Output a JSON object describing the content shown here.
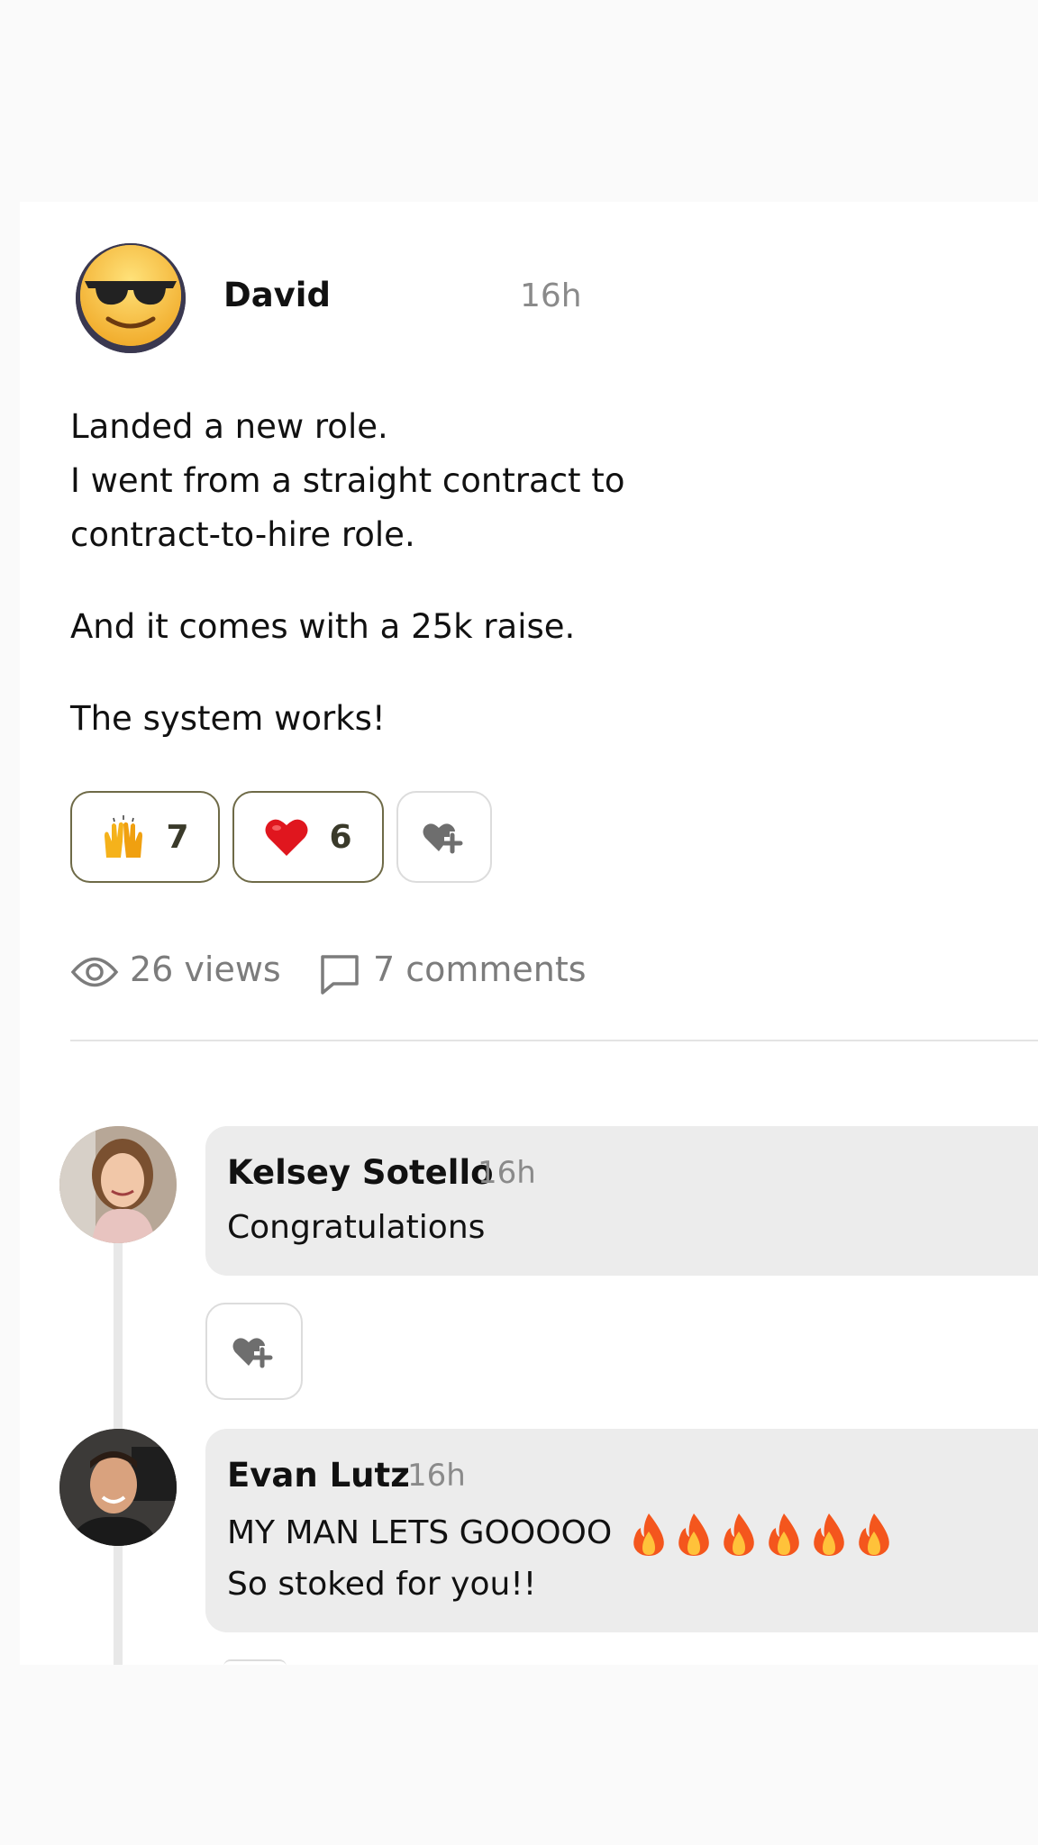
{
  "post": {
    "author": "David",
    "time": "16h",
    "avatar_icon": "sunglasses-emoji-icon",
    "body": {
      "line1": "Landed a new role.",
      "line2": "I went from a straight contract to",
      "line3": "contract-to-hire role.",
      "line4": "And it comes with a 25k raise.",
      "line5": "The system works!"
    },
    "reactions": [
      {
        "icon": "raising-hands-emoji-icon",
        "count": "7"
      },
      {
        "icon": "red-heart-emoji-icon",
        "count": "6"
      }
    ],
    "add_reaction_icon": "heart-plus-icon",
    "stats": {
      "views": "26 views",
      "comments": "7 comments"
    }
  },
  "comments": [
    {
      "author": "Kelsey Sotello",
      "time": "16h",
      "text": "Congratulations"
    },
    {
      "author": "Evan Lutz",
      "time": "16h",
      "text_line1": "MY MAN LETS GOOOOO",
      "fire_count": 6,
      "text_line2": "So stoked for you!!"
    }
  ],
  "colors": {
    "reaction_border": "#6e6a47",
    "muted_text": "#8a8a8a",
    "bubble_bg": "#ececec"
  }
}
